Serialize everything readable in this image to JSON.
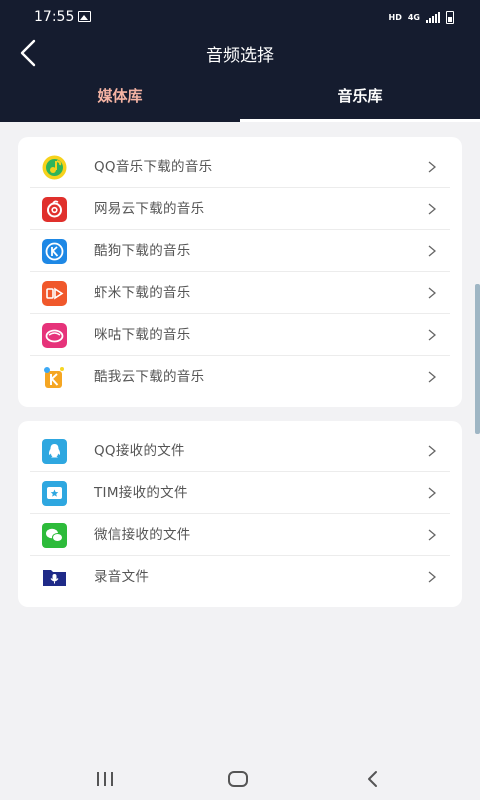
{
  "status_bar": {
    "time": "17:55",
    "hd": "HD",
    "network": "4G"
  },
  "header": {
    "title": "音频选择"
  },
  "tabs": [
    {
      "label": "媒体库"
    },
    {
      "label": "音乐库"
    }
  ],
  "music_sources": [
    {
      "label": "QQ音乐下载的音乐",
      "icon": "qq-music-icon"
    },
    {
      "label": "网易云下载的音乐",
      "icon": "netease-cloud-music-icon"
    },
    {
      "label": "酷狗下载的音乐",
      "icon": "kugou-icon"
    },
    {
      "label": "虾米下载的音乐",
      "icon": "xiami-icon"
    },
    {
      "label": "咪咕下载的音乐",
      "icon": "migu-icon"
    },
    {
      "label": "酷我云下载的音乐",
      "icon": "kuwo-icon"
    }
  ],
  "file_sources": [
    {
      "label": "QQ接收的文件",
      "icon": "qq-icon"
    },
    {
      "label": "TIM接收的文件",
      "icon": "tim-icon"
    },
    {
      "label": "微信接收的文件",
      "icon": "wechat-icon"
    },
    {
      "label": "录音文件",
      "icon": "recording-icon"
    }
  ],
  "colors": {
    "header_bg": "#151c2f",
    "active_tab": "#f4b3a3",
    "page_bg": "#f2f2f4"
  }
}
